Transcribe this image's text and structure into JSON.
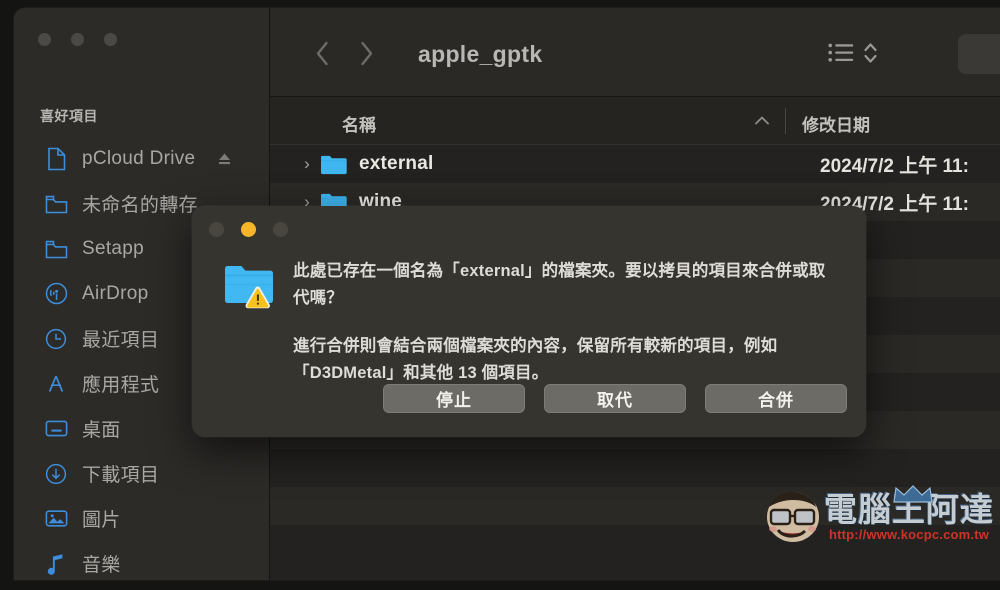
{
  "window": {
    "traffic_lights": [
      "close",
      "minimize",
      "zoom"
    ]
  },
  "sidebar": {
    "section_title": "喜好項目",
    "items": [
      {
        "label": "pCloud Drive",
        "icon": "document-icon",
        "eject": true
      },
      {
        "label": "未命名的轉存",
        "icon": "folder-icon",
        "eject": false
      },
      {
        "label": "Setapp",
        "icon": "folder-icon",
        "eject": false
      },
      {
        "label": "AirDrop",
        "icon": "airdrop-icon",
        "eject": false
      },
      {
        "label": "最近項目",
        "icon": "clock-icon",
        "eject": false
      },
      {
        "label": "應用程式",
        "icon": "applications-icon",
        "eject": false
      },
      {
        "label": "桌面",
        "icon": "desktop-icon",
        "eject": false
      },
      {
        "label": "下載項目",
        "icon": "download-icon",
        "eject": false
      },
      {
        "label": "圖片",
        "icon": "pictures-icon",
        "eject": false
      },
      {
        "label": "音樂",
        "icon": "music-icon",
        "eject": false
      }
    ]
  },
  "toolbar": {
    "back_icon": "chevron-left-icon",
    "forward_icon": "chevron-right-icon",
    "folder_title": "apple_gptk",
    "view_icon": "list-view-icon",
    "view_chevron_icon": "chevron-up-down-icon"
  },
  "columns": {
    "name": "名稱",
    "sort_caret": "▲",
    "date_modified": "修改日期"
  },
  "files": [
    {
      "name": "external",
      "date": "2024/7/2 上午 11:",
      "disclosure": "›",
      "icon": "folder-icon"
    },
    {
      "name": "wine",
      "date": "2024/7/2 上午 11:",
      "disclosure": "›",
      "icon": "folder-icon"
    }
  ],
  "dialog": {
    "icon": "folder-warning-icon",
    "message_1": "此處已存在一個名為「external」的檔案夾。要以拷貝的項目來合併或取代嗎？",
    "message_2": "進行合併則會結合兩個檔案夾的內容，保留所有較新的項目，例如「D3DMetal」和其他 13 個項目。",
    "buttons": [
      {
        "label": "停止",
        "name": "stop-button"
      },
      {
        "label": "取代",
        "name": "replace-button"
      },
      {
        "label": "合併",
        "name": "merge-button"
      }
    ]
  },
  "watermark": {
    "title": "電腦王阿達",
    "url": "http://www.kocpc.com.tw"
  },
  "colors": {
    "accent_blue": "#3d8ddb",
    "amber": "#f7b52b",
    "sidebar_bg": "#2c2b28",
    "content_bg": "#232220",
    "dialog_bg": "#36342f",
    "watermark_red": "#d6342a"
  }
}
